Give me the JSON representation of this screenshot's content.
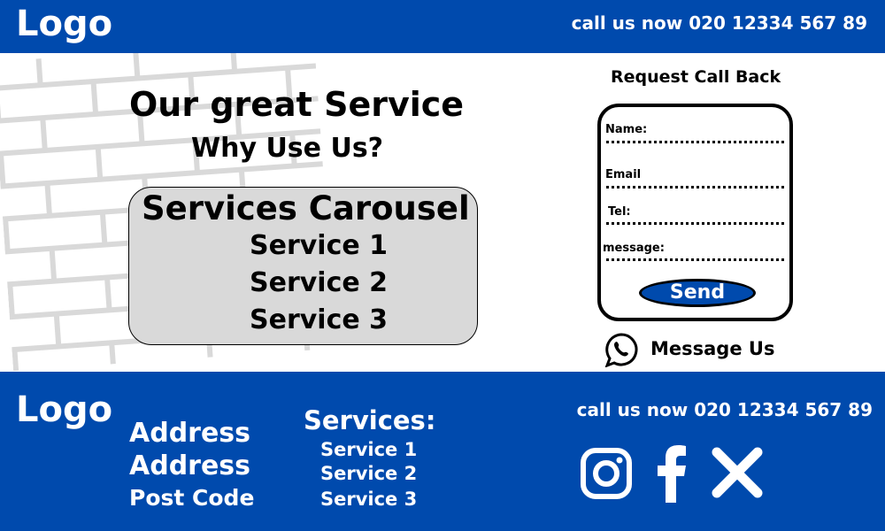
{
  "header": {
    "logo": "Logo",
    "phone": "call us now 020 12334 567 89"
  },
  "hero": {
    "title": "Our great Service",
    "subtitle": "Why Use Us?"
  },
  "carousel": {
    "title": "Services Carousel",
    "items": [
      "Service 1",
      "Service 2",
      "Service 3"
    ]
  },
  "callback": {
    "title": "Request Call Back",
    "fields": [
      "Name:",
      "Email",
      "Tel:",
      "message:"
    ],
    "send_label": "Send",
    "message_us": "Message Us"
  },
  "footer": {
    "logo": "Logo",
    "address": [
      "Address",
      "Address",
      "Post Code"
    ],
    "services_title": "Services:",
    "services": [
      "Service 1",
      "Service 2",
      "Service 3"
    ],
    "phone": "call us now 020 12334 567 89",
    "social_icons": [
      "instagram-icon",
      "facebook-icon",
      "x-icon"
    ]
  },
  "colors": {
    "brand": "#004aad",
    "carousel_bg": "#d9d9d9",
    "brick": "#d9d9d9"
  }
}
